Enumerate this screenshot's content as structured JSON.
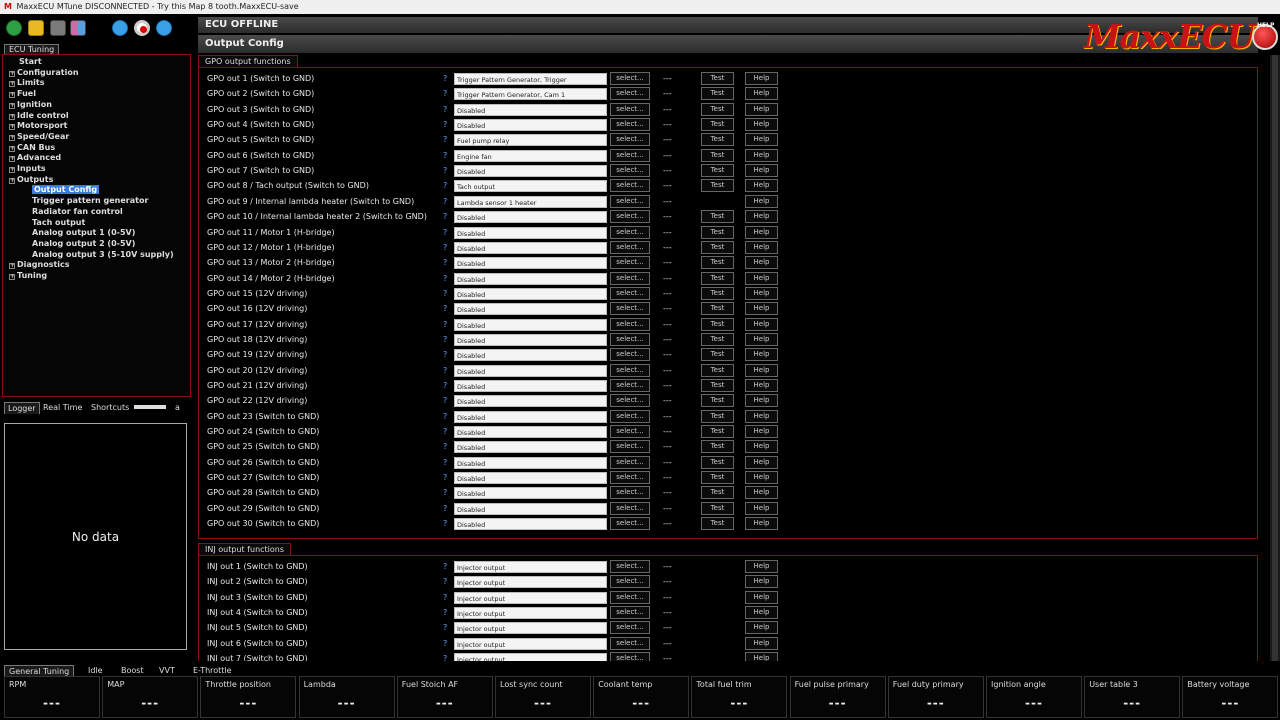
{
  "window": {
    "title": "MaxxECU MTune DISCONNECTED - Try this Map 8 tooth.MaxxECU-save",
    "logo_text": "MaxxECU",
    "help_badge": "HELP"
  },
  "header": {
    "status": "ECU OFFLINE",
    "page_title": "Output Config"
  },
  "left": {
    "tab": "ECU Tuning",
    "tree": [
      {
        "label": "Start",
        "level": 0,
        "expandable": false
      },
      {
        "label": "Configuration",
        "level": 0,
        "expandable": true
      },
      {
        "label": "Limits",
        "level": 0,
        "expandable": true
      },
      {
        "label": "Fuel",
        "level": 0,
        "expandable": true
      },
      {
        "label": "Ignition",
        "level": 0,
        "expandable": true
      },
      {
        "label": "Idle control",
        "level": 0,
        "expandable": true
      },
      {
        "label": "Motorsport",
        "level": 0,
        "expandable": true
      },
      {
        "label": "Speed/Gear",
        "level": 0,
        "expandable": true
      },
      {
        "label": "CAN Bus",
        "level": 0,
        "expandable": true
      },
      {
        "label": "Advanced",
        "level": 0,
        "expandable": true
      },
      {
        "label": "Inputs",
        "level": 0,
        "expandable": true
      },
      {
        "label": "Outputs",
        "level": 0,
        "expandable": true
      },
      {
        "label": "Output Config",
        "level": 1,
        "expandable": false,
        "selected": true
      },
      {
        "label": "Trigger pattern generator",
        "level": 1,
        "expandable": false
      },
      {
        "label": "Radiator fan control",
        "level": 1,
        "expandable": false
      },
      {
        "label": "Tach output",
        "level": 1,
        "expandable": false
      },
      {
        "label": "Analog output 1 (0-5V)",
        "level": 1,
        "expandable": false
      },
      {
        "label": "Analog output 2 (0-5V)",
        "level": 1,
        "expandable": false
      },
      {
        "label": "Analog output 3 (5-10V supply)",
        "level": 1,
        "expandable": false
      },
      {
        "label": "Diagnostics",
        "level": 0,
        "expandable": true
      },
      {
        "label": "Tuning",
        "level": 0,
        "expandable": true
      }
    ],
    "log_tabs": [
      "Logger",
      "Real Time",
      "Shortcuts",
      "a"
    ],
    "log_empty": "No data"
  },
  "gpo": {
    "title": "GPO output functions",
    "select_label": "select...",
    "dash": "---",
    "test_label": "Test",
    "help_label": "Help",
    "question": "?",
    "rows": [
      {
        "label": "GPO out 1 (Switch to GND)",
        "value": "Trigger Pattern Generator, Trigger",
        "test": true
      },
      {
        "label": "GPO out 2 (Switch to GND)",
        "value": "Trigger Pattern Generator, Cam 1",
        "test": true
      },
      {
        "label": "GPO out 3 (Switch to GND)",
        "value": "Disabled",
        "test": true
      },
      {
        "label": "GPO out 4 (Switch to GND)",
        "value": "Disabled",
        "test": true
      },
      {
        "label": "GPO out 5 (Switch to GND)",
        "value": "Fuel pump relay",
        "test": true
      },
      {
        "label": "GPO out 6 (Switch to GND)",
        "value": "Engine fan",
        "test": true
      },
      {
        "label": "GPO out 7 (Switch to GND)",
        "value": "Disabled",
        "test": true
      },
      {
        "label": "GPO out 8 / Tach output (Switch to GND)",
        "value": "Tach output",
        "test": true
      },
      {
        "label": "GPO out 9 / Internal lambda heater (Switch to GND)",
        "value": "Lambda sensor 1 heater",
        "test": false
      },
      {
        "label": "GPO out 10 / Internal lambda heater 2 (Switch to GND)",
        "value": "Disabled",
        "test": true
      },
      {
        "label": "GPO out 11 / Motor 1 (H-bridge)",
        "value": "Disabled",
        "test": true
      },
      {
        "label": "GPO out 12 / Motor 1 (H-bridge)",
        "value": "Disabled",
        "test": true
      },
      {
        "label": "GPO out 13 / Motor 2 (H-bridge)",
        "value": "Disabled",
        "test": true
      },
      {
        "label": "GPO out 14 / Motor 2 (H-bridge)",
        "value": "Disabled",
        "test": true
      },
      {
        "label": "GPO out 15 (12V driving)",
        "value": "Disabled",
        "test": true
      },
      {
        "label": "GPO out 16 (12V driving)",
        "value": "Disabled",
        "test": true
      },
      {
        "label": "GPO out 17 (12V driving)",
        "value": "Disabled",
        "test": true
      },
      {
        "label": "GPO out 18 (12V driving)",
        "value": "Disabled",
        "test": true
      },
      {
        "label": "GPO out 19 (12V driving)",
        "value": "Disabled",
        "test": true
      },
      {
        "label": "GPO out 20 (12V driving)",
        "value": "Disabled",
        "test": true
      },
      {
        "label": "GPO out 21 (12V driving)",
        "value": "Disabled",
        "test": true
      },
      {
        "label": "GPO out 22 (12V driving)",
        "value": "Disabled",
        "test": true
      },
      {
        "label": "GPO out 23 (Switch to GND)",
        "value": "Disabled",
        "test": true
      },
      {
        "label": "GPO out 24 (Switch to GND)",
        "value": "Disabled",
        "test": true
      },
      {
        "label": "GPO out 25 (Switch to GND)",
        "value": "Disabled",
        "test": true
      },
      {
        "label": "GPO out 26 (Switch to GND)",
        "value": "Disabled",
        "test": true
      },
      {
        "label": "GPO out 27 (Switch to GND)",
        "value": "Disabled",
        "test": true
      },
      {
        "label": "GPO out 28 (Switch to GND)",
        "value": "Disabled",
        "test": true
      },
      {
        "label": "GPO out 29 (Switch to GND)",
        "value": "Disabled",
        "test": true
      },
      {
        "label": "GPO out 30 (Switch to GND)",
        "value": "Disabled",
        "test": true
      }
    ]
  },
  "inj": {
    "title": "INJ output functions",
    "rows": [
      {
        "label": "INJ out 1 (Switch to GND)",
        "value": "Injector output",
        "test": false
      },
      {
        "label": "INJ out 2 (Switch to GND)",
        "value": "Injector output",
        "test": false
      },
      {
        "label": "INJ out 3 (Switch to GND)",
        "value": "Injector output",
        "test": false
      },
      {
        "label": "INJ out 4 (Switch to GND)",
        "value": "Injector output",
        "test": false
      },
      {
        "label": "INJ out 5 (Switch to GND)",
        "value": "Injector output",
        "test": false
      },
      {
        "label": "INJ out 6 (Switch to GND)",
        "value": "Injector output",
        "test": false
      },
      {
        "label": "INJ out 7 (Switch to GND)",
        "value": "Injector output",
        "test": false
      }
    ]
  },
  "bottom": {
    "tabs": [
      "General Tuning",
      "Idle",
      "Boost",
      "VVT",
      "E-Throttle"
    ],
    "gauges": [
      {
        "name": "RPM",
        "value": "---"
      },
      {
        "name": "MAP",
        "value": "---"
      },
      {
        "name": "Throttle position",
        "value": "---"
      },
      {
        "name": "Lambda",
        "value": "---"
      },
      {
        "name": "Fuel Stoich AF",
        "value": "---"
      },
      {
        "name": "Lost sync count",
        "value": "---"
      },
      {
        "name": "Coolant temp",
        "value": "---"
      },
      {
        "name": "Total fuel trim",
        "value": "---"
      },
      {
        "name": "Fuel pulse primary",
        "value": "---"
      },
      {
        "name": "Fuel duty primary",
        "value": "---"
      },
      {
        "name": "Ignition angle",
        "value": "---"
      },
      {
        "name": "User table 3",
        "value": "---"
      },
      {
        "name": "Battery voltage",
        "value": "---"
      }
    ]
  },
  "colors": {
    "accent_red": "#8a0f0f",
    "selection_blue": "#3b78d8",
    "help_question": "#5da0ff"
  }
}
